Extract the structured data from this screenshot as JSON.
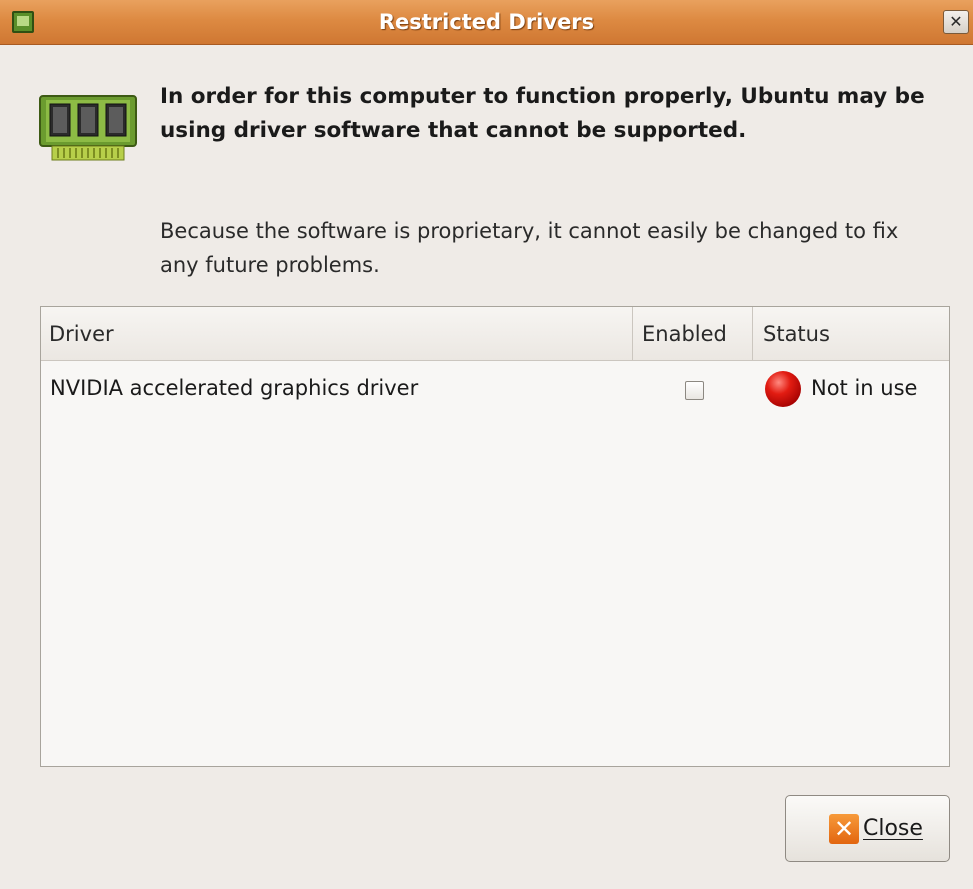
{
  "window": {
    "title": "Restricted Drivers",
    "close_glyph": "✕"
  },
  "message": {
    "heading": "In order for this computer to function properly, Ubuntu may be using driver software that cannot be supported.",
    "body": "Because the software is proprietary, it cannot easily be changed to fix any future problems."
  },
  "drivers_table": {
    "columns": [
      "Driver",
      "Enabled",
      "Status"
    ],
    "rows": [
      {
        "driver": "NVIDIA accelerated graphics driver",
        "enabled": false,
        "status": "Not in use",
        "status_color": "#d40000"
      }
    ]
  },
  "buttons": {
    "close_label": "Close",
    "close_icon": "close-icon"
  },
  "icons": {
    "title_icon": "hardware-chip-icon",
    "dialog_icon": "hardware-chip-icon"
  },
  "colors": {
    "titlebar": "#dd8a42",
    "background": "#efebe7",
    "status_red": "#d40000",
    "close_icon_orange": "#e8721c"
  }
}
